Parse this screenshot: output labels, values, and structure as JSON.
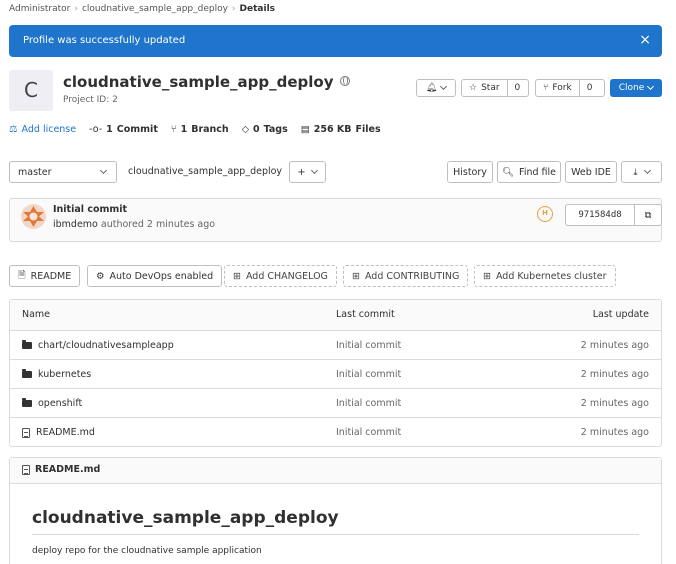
{
  "breadcrumb": [
    "Administrator",
    "cloudnative_sample_app_deploy",
    "Details"
  ],
  "alert": {
    "text": "Profile was successfully updated",
    "close": "×"
  },
  "project": {
    "avatar_letter": "C",
    "name": "cloudnative_sample_app_deploy",
    "id_label": "Project ID: 2"
  },
  "actions": {
    "notify_icon": "bell-icon",
    "star": "Star",
    "star_count": "0",
    "fork": "Fork",
    "fork_count": "0",
    "clone": "Clone"
  },
  "stats": {
    "license": "Add license",
    "commits_num": "1",
    "commits_lbl": "Commit",
    "branches_num": "1",
    "branches_lbl": "Branch",
    "tags_num": "0",
    "tags_lbl": "Tags",
    "size_num": "256 KB",
    "size_lbl": "Files"
  },
  "repo_bar": {
    "branch": "master",
    "path": "cloudnative_sample_app_deploy",
    "slash": "/",
    "plus": "+",
    "history": "History",
    "find_file": "Find file",
    "web_ide": "Web IDE"
  },
  "commit": {
    "title": "Initial commit",
    "author": "ibmdemo",
    "meta": "authored 2 minutes ago",
    "pipeline": "H",
    "sha": "971584d8"
  },
  "shortcuts": {
    "readme": "README",
    "autodevops": "Auto DevOps enabled",
    "changelog": "Add CHANGELOG",
    "contributing": "Add CONTRIBUTING",
    "k8s": "Add Kubernetes cluster"
  },
  "table": {
    "headers": [
      "Name",
      "Last commit",
      "Last update"
    ],
    "rows": [
      {
        "name": "chart/cloudnativesampleapp",
        "commit": "Initial commit",
        "updated": "2 minutes ago",
        "type": "folder"
      },
      {
        "name": "kubernetes",
        "commit": "Initial commit",
        "updated": "2 minutes ago",
        "type": "folder"
      },
      {
        "name": "openshift",
        "commit": "Initial commit",
        "updated": "2 minutes ago",
        "type": "folder"
      },
      {
        "name": "README.md",
        "commit": "Initial commit",
        "updated": "2 minutes ago",
        "type": "file"
      }
    ]
  },
  "readme": {
    "file": "README.md",
    "heading": "cloudnative_sample_app_deploy",
    "body": "deploy repo for the cloudnative sample application"
  },
  "colors": {
    "accent": "#1f75cb",
    "pipeline": "#e9a23b"
  }
}
